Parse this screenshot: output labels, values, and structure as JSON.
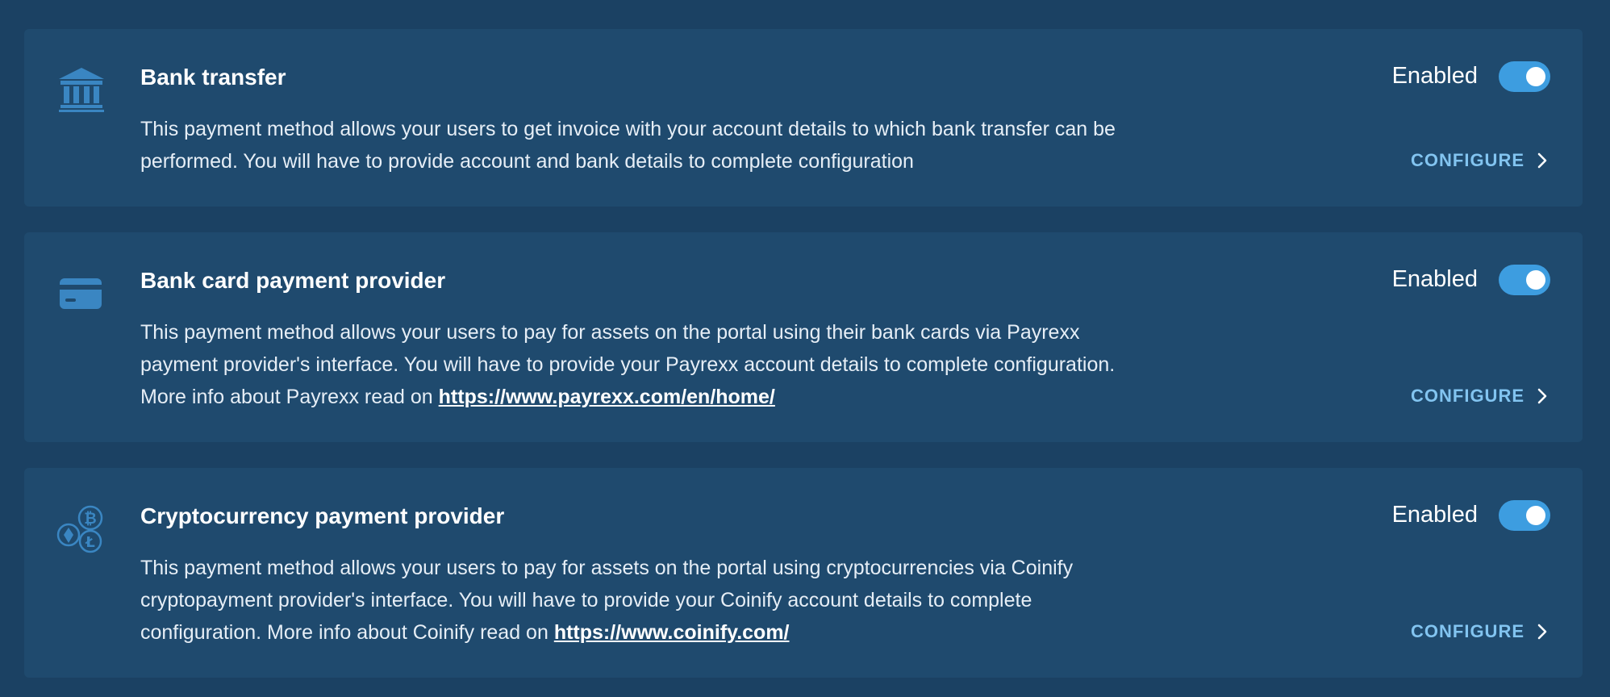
{
  "colors": {
    "page_background": "#1b4163",
    "card_background": "#1f4a6e",
    "accent": "#3d9de0",
    "configure_text": "#82c4f0",
    "icon": "#3a86c2"
  },
  "methods": [
    {
      "icon": "bank-icon",
      "title": "Bank transfer",
      "description_text": "This payment method allows your users to get invoice with your account details to which bank transfer can be performed. You will have to provide account and bank details to complete configuration",
      "link": "",
      "status": "Enabled",
      "enabled": true,
      "configure_label": "CONFIGURE"
    },
    {
      "icon": "credit-card-icon",
      "title": "Bank card payment provider",
      "description_text": "This payment method allows your users to pay for assets on the portal using their bank cards via Payrexx payment provider's interface. You will have to provide your Payrexx account details to complete configuration. More info about Payrexx read on ",
      "link": "https://www.payrexx.com/en/home/",
      "status": "Enabled",
      "enabled": true,
      "configure_label": "CONFIGURE"
    },
    {
      "icon": "crypto-coins-icon",
      "title": "Cryptocurrency payment provider",
      "description_text": "This payment method allows your users to pay for assets on the portal using cryptocurrencies via Coinify cryptopayment provider's interface. You will have to provide your Coinify account details to complete configuration. More info about Coinify read on ",
      "link": "https://www.coinify.com/",
      "status": "Enabled",
      "enabled": true,
      "configure_label": "CONFIGURE"
    }
  ]
}
